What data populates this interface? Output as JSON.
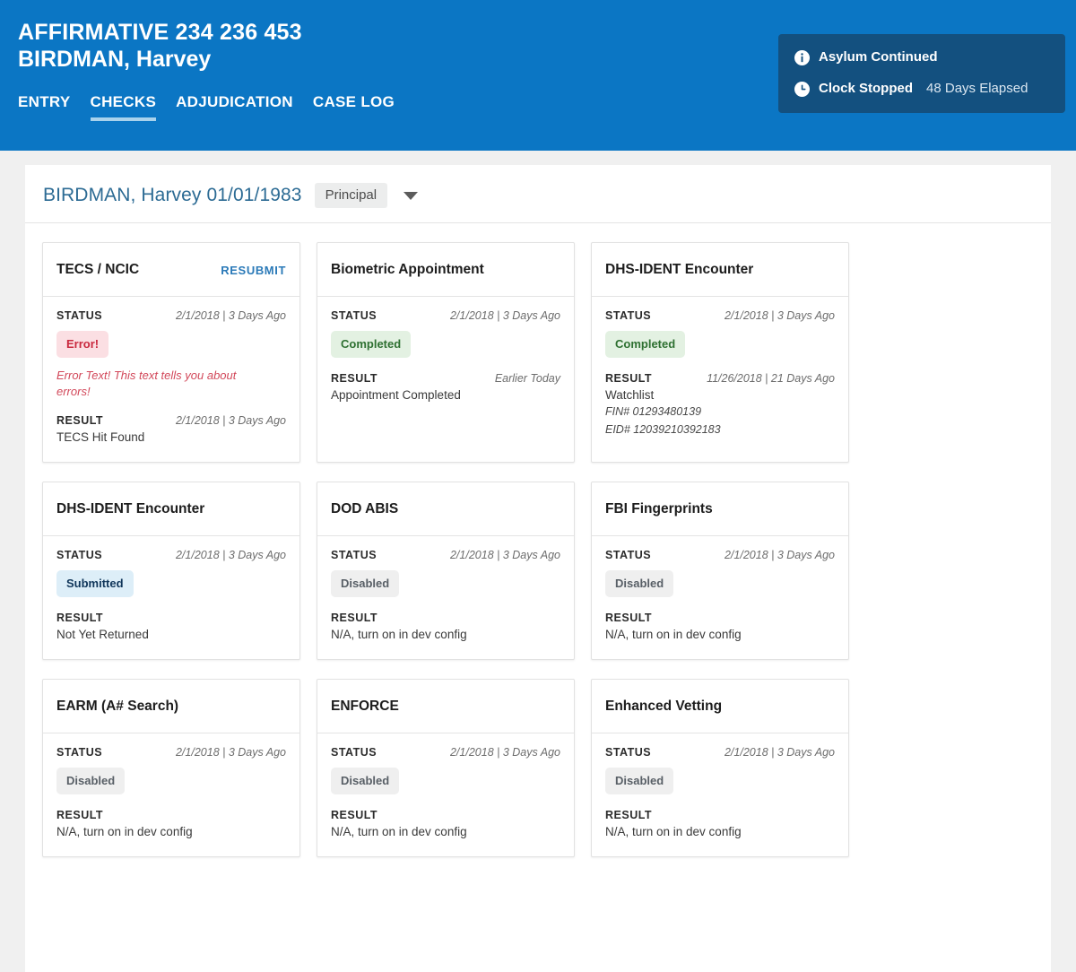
{
  "header": {
    "case_id": "AFFIRMATIVE 234 236 453",
    "case_name": "BIRDMAN, Harvey",
    "brand_color": "#0b76c4",
    "tabs": [
      {
        "label": "ENTRY",
        "active": false
      },
      {
        "label": "CHECKS",
        "active": true
      },
      {
        "label": "ADJUDICATION",
        "active": false
      },
      {
        "label": "CASE LOG",
        "active": false
      }
    ],
    "status_panel": {
      "background": "#13507f",
      "rows": [
        {
          "icon": "info-circle-icon",
          "label": "Asylum Continued",
          "extra": ""
        },
        {
          "icon": "clock-icon",
          "label": "Clock Stopped",
          "extra": "48 Days Elapsed"
        }
      ]
    }
  },
  "person": {
    "name_dob": "BIRDMAN, Harvey 01/01/1983",
    "role": "Principal",
    "caret": "chevron-down-icon"
  },
  "labels": {
    "status": "STATUS",
    "result": "RESULT"
  },
  "cards": [
    {
      "title": "TECS / NCIC",
      "action": "RESUBMIT",
      "status_date": "2/1/2018 | 3 Days Ago",
      "badge": {
        "text": "Error!",
        "variant": "error"
      },
      "error_text": "Error Text! This text tells you about errors!",
      "result_date": "2/1/2018 | 3 Days Ago",
      "result_value": "TECS Hit Found",
      "details": []
    },
    {
      "title": "Biometric Appointment",
      "action": "",
      "status_date": "2/1/2018 | 3 Days Ago",
      "badge": {
        "text": "Completed",
        "variant": "completed"
      },
      "error_text": "",
      "result_date": "Earlier Today",
      "result_value": "Appointment Completed",
      "details": []
    },
    {
      "title": "DHS-IDENT Encounter",
      "action": "",
      "status_date": "2/1/2018 | 3 Days Ago",
      "badge": {
        "text": "Completed",
        "variant": "completed"
      },
      "error_text": "",
      "result_date": "11/26/2018 | 21 Days Ago",
      "result_value": "Watchlist",
      "details": [
        "FIN# 01293480139",
        "EID# 12039210392183"
      ]
    },
    {
      "title": "DHS-IDENT Encounter",
      "action": "",
      "status_date": "2/1/2018 | 3 Days Ago",
      "badge": {
        "text": "Submitted",
        "variant": "submitted"
      },
      "error_text": "",
      "result_date": "",
      "result_value": "Not Yet Returned",
      "details": []
    },
    {
      "title": "DOD ABIS",
      "action": "",
      "status_date": "2/1/2018 | 3 Days Ago",
      "badge": {
        "text": "Disabled",
        "variant": "disabled"
      },
      "error_text": "",
      "result_date": "",
      "result_value": "N/A, turn on in dev config",
      "details": []
    },
    {
      "title": "FBI Fingerprints",
      "action": "",
      "status_date": "2/1/2018 | 3 Days Ago",
      "badge": {
        "text": "Disabled",
        "variant": "disabled"
      },
      "error_text": "",
      "result_date": "",
      "result_value": "N/A, turn on in dev config",
      "details": []
    },
    {
      "title": "EARM (A# Search)",
      "action": "",
      "status_date": "2/1/2018 | 3 Days Ago",
      "badge": {
        "text": "Disabled",
        "variant": "disabled"
      },
      "error_text": "",
      "result_date": "",
      "result_value": "N/A, turn on in dev config",
      "details": []
    },
    {
      "title": "ENFORCE",
      "action": "",
      "status_date": "2/1/2018 | 3 Days Ago",
      "badge": {
        "text": "Disabled",
        "variant": "disabled"
      },
      "error_text": "",
      "result_date": "",
      "result_value": "N/A, turn on in dev config",
      "details": []
    },
    {
      "title": "Enhanced Vetting",
      "action": "",
      "status_date": "2/1/2018 | 3 Days Ago",
      "badge": {
        "text": "Disabled",
        "variant": "disabled"
      },
      "error_text": "",
      "result_date": "",
      "result_value": "N/A, turn on in dev config",
      "details": []
    }
  ]
}
